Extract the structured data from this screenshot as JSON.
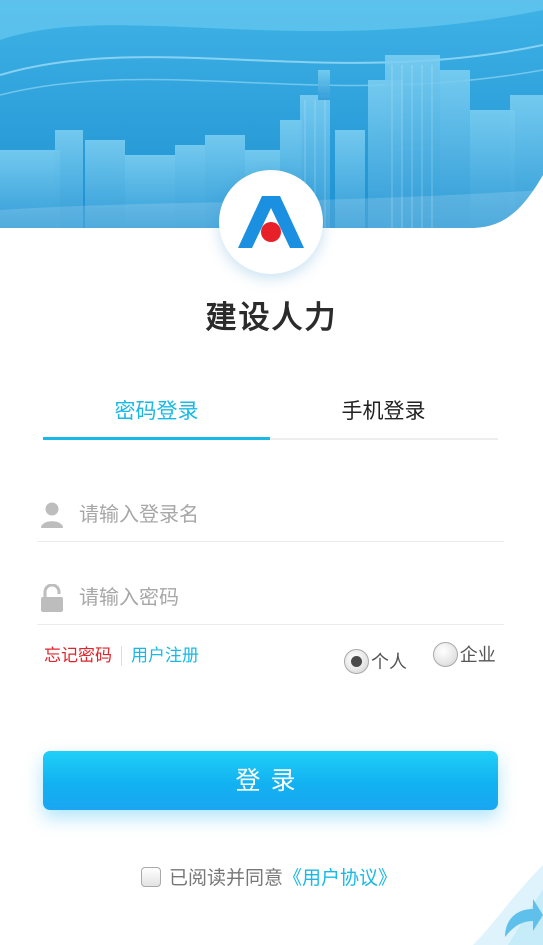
{
  "app": {
    "title": "建设人力"
  },
  "tabs": [
    {
      "label": "密码登录",
      "active": true
    },
    {
      "label": "手机登录",
      "active": false
    }
  ],
  "fields": {
    "username": {
      "placeholder": "请输入登录名",
      "value": "",
      "icon": "user-icon"
    },
    "password": {
      "placeholder": "请输入密码",
      "value": "",
      "icon": "lock-icon"
    }
  },
  "links": {
    "forgot": "忘记密码",
    "register": "用户注册"
  },
  "user_type": {
    "options": [
      {
        "label": "个人",
        "selected": true
      },
      {
        "label": "企业",
        "selected": false
      }
    ]
  },
  "login_button": {
    "label": "登录"
  },
  "agreement": {
    "text": "已阅读并同意",
    "link": "《用户协议》",
    "checked": false
  },
  "colors": {
    "accent": "#18b9e6",
    "danger": "#e0242b",
    "logo_blue": "#1b8fe0",
    "logo_red": "#e8202a"
  }
}
